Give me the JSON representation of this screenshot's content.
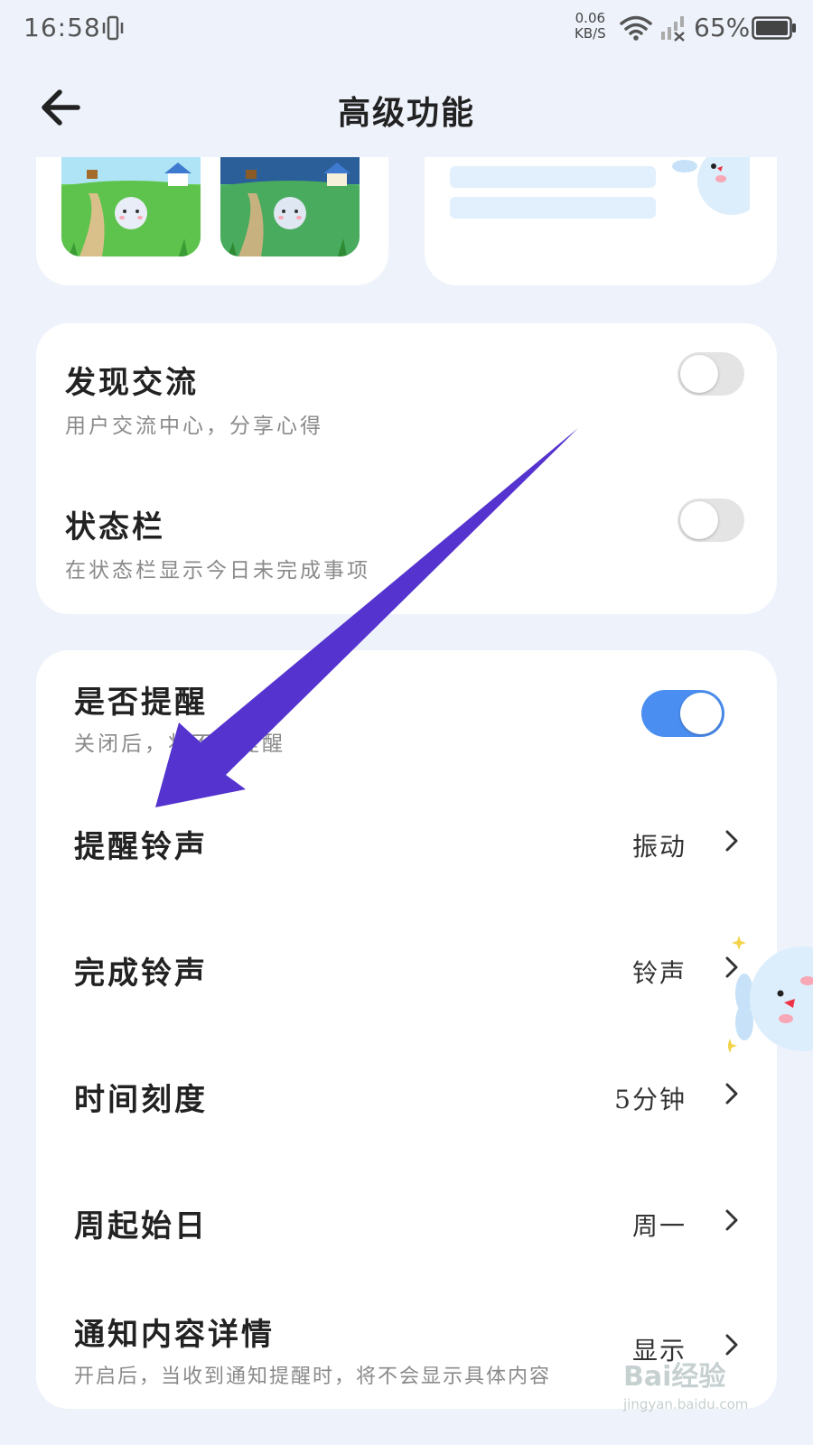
{
  "status_bar": {
    "time": "16:58",
    "net_speed_value": "0.06",
    "net_speed_unit": "KB/S",
    "battery": "65%"
  },
  "header": {
    "title": "高级功能",
    "back_icon": "arrow-left-icon"
  },
  "settings_group_1": [
    {
      "title": "发现交流",
      "subtitle": "用户交流中心，分享心得",
      "toggle": false
    },
    {
      "title": "状态栏",
      "subtitle": "在状态栏显示今日未完成事项",
      "toggle": false
    }
  ],
  "settings_group_2": {
    "reminder": {
      "title": "是否提醒",
      "subtitle": "关闭后，将不再提醒",
      "toggle": true
    },
    "ringtone": {
      "title": "提醒铃声",
      "value": "振动"
    },
    "finish_ringtone": {
      "title": "完成铃声",
      "value": "铃声"
    },
    "time_scale": {
      "title": "时间刻度",
      "value": "5分钟"
    },
    "week_start": {
      "title": "周起始日",
      "value": "周一"
    },
    "notify_detail": {
      "title": "通知内容详情",
      "subtitle": "开启后，当收到通知提醒时，将不会显示具体内容",
      "value": "显示"
    }
  },
  "watermark": {
    "brand": "Bai经验",
    "url": "jingyan.baidu.com"
  },
  "colors": {
    "background": "#eef2fb",
    "card": "#ffffff",
    "toggle_on": "#4b8ef1",
    "toggle_off": "#e4e4e4",
    "annotation_arrow": "#5433cf"
  }
}
